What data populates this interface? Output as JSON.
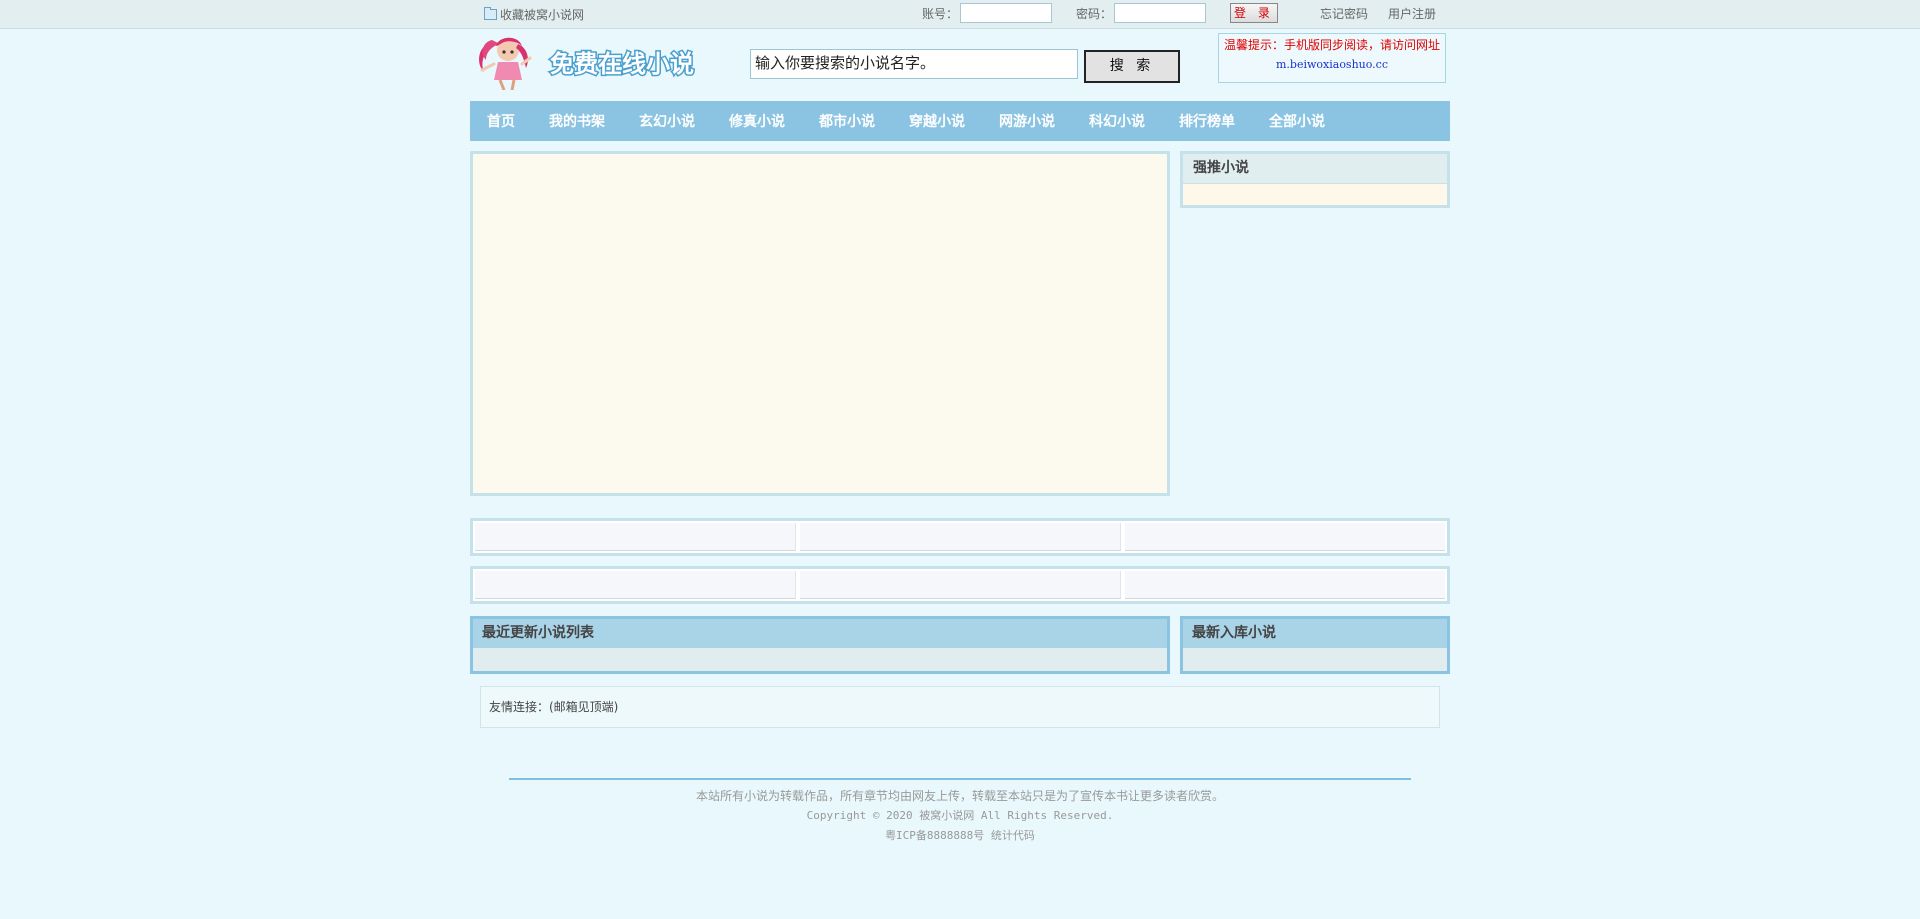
{
  "topbar": {
    "favorite_label": "收藏被窝小说网",
    "account_label": "账号：",
    "password_label": "密码：",
    "login_button": "登 录",
    "forgot_password": "忘记密码",
    "register": "用户注册"
  },
  "header": {
    "logo_text": "免费在线小说",
    "search_placeholder": "输入你要搜索的小说名字。",
    "search_button": "搜 索",
    "notice_text": "温馨提示：手机版同步阅读，请访问网址",
    "notice_url": "m.beiwoxiaoshuo.cc"
  },
  "nav": {
    "items": [
      "首页",
      "我的书架",
      "玄幻小说",
      "修真小说",
      "都市小说",
      "穿越小说",
      "网游小说",
      "科幻小说",
      "排行榜单",
      "全部小说"
    ]
  },
  "sidebar": {
    "recommend_title": "强推小说"
  },
  "lists": {
    "recent_updates_title": "最近更新小说列表",
    "new_books_title": "最新入库小说"
  },
  "friends": {
    "label": "友情连接：(邮箱见顶端)"
  },
  "footer": {
    "line1": "本站所有小说为转载作品，所有章节均由网友上传，转载至本站只是为了宣传本书让更多读者欣赏。",
    "line2": "Copyright © 2020 被窝小说网 All Rights Reserved.",
    "line3": "粤ICP备8888888号 统计代码"
  },
  "colors": {
    "page_bg": "#e8f8fc",
    "nav_bg": "#8bc4e2",
    "notice_red": "#e00000",
    "notice_link": "#1a33c8"
  }
}
